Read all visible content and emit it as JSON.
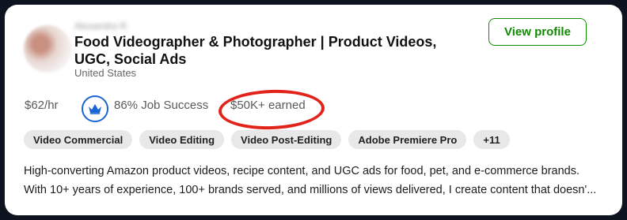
{
  "profile": {
    "name": "Alexandra R.",
    "title": "Food Videographer & Photographer | Product Videos, UGC, Social Ads",
    "location": "United States"
  },
  "actions": {
    "view_profile": "View profile"
  },
  "stats": {
    "rate": "$62/hr",
    "job_success": "86% Job Success",
    "earned": "$50K+ earned"
  },
  "skills": [
    "Video Commercial",
    "Video Editing",
    "Video Post-Editing",
    "Adobe Premiere Pro",
    "+11"
  ],
  "description": {
    "line1": "High-converting Amazon product videos, recipe content, and UGC ads for food, pet, and e-commerce brands.",
    "line2": "With 10+ years of experience, 100+ brands served, and millions of views delivered, I create content that doesn'..."
  },
  "colors": {
    "accent_green": "#108a00",
    "badge_blue": "#1a66d1",
    "highlight_red": "#e2231a"
  },
  "icons": {
    "job_success_badge": "crown-badge-icon"
  }
}
